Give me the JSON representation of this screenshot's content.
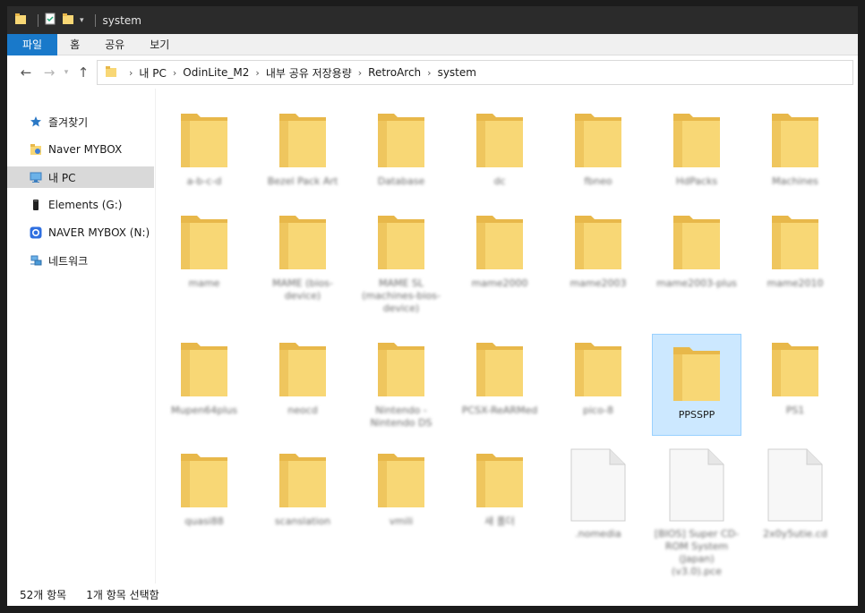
{
  "window": {
    "title": "system"
  },
  "ribbon": {
    "tabs": [
      "파일",
      "홈",
      "공유",
      "보기"
    ]
  },
  "address": {
    "crumbs": [
      "내 PC",
      "OdinLite_M2",
      "내부 공유 저장용량",
      "RetroArch",
      "system"
    ]
  },
  "sidebar": {
    "items": [
      {
        "label": "즐겨찾기",
        "icon": "star-icon"
      },
      {
        "label": "Naver MYBOX",
        "icon": "cloud-folder-icon"
      },
      {
        "label": "내 PC",
        "icon": "pc-icon"
      },
      {
        "label": "Elements (G:)",
        "icon": "drive-icon"
      },
      {
        "label": "NAVER MYBOX (N:)",
        "icon": "mybox-drive-icon"
      },
      {
        "label": "네트워크",
        "icon": "network-icon"
      }
    ]
  },
  "content": {
    "items": [
      {
        "label": "a-b-c-d",
        "type": "folder",
        "blur": true
      },
      {
        "label": "Bezel Pack Art",
        "type": "folder",
        "blur": true
      },
      {
        "label": "Database",
        "type": "folder",
        "blur": true
      },
      {
        "label": "dc",
        "type": "folder",
        "blur": true
      },
      {
        "label": "fbneo",
        "type": "folder",
        "blur": true
      },
      {
        "label": "HdPacks",
        "type": "folder",
        "blur": true
      },
      {
        "label": "Machines",
        "type": "folder",
        "blur": true
      },
      {
        "label": "mame",
        "type": "folder",
        "blur": true
      },
      {
        "label": "MAME (bios-device)",
        "type": "folder",
        "blur": true
      },
      {
        "label": "MAME SL (machines-bios-device)",
        "type": "folder",
        "blur": true
      },
      {
        "label": "mame2000",
        "type": "folder",
        "blur": true
      },
      {
        "label": "mame2003",
        "type": "folder",
        "blur": true
      },
      {
        "label": "mame2003-plus",
        "type": "folder",
        "blur": true
      },
      {
        "label": "mame2010",
        "type": "folder",
        "blur": true
      },
      {
        "label": "Mupen64plus",
        "type": "folder",
        "blur": true
      },
      {
        "label": "neocd",
        "type": "folder",
        "blur": true
      },
      {
        "label": "Nintendo - Nintendo DS",
        "type": "folder",
        "blur": true
      },
      {
        "label": "PCSX-ReARMed",
        "type": "folder",
        "blur": true
      },
      {
        "label": "pico-8",
        "type": "folder",
        "blur": true
      },
      {
        "label": "PPSSPP",
        "type": "folder",
        "blur": false,
        "selected": true
      },
      {
        "label": "PS1",
        "type": "folder",
        "blur": true
      },
      {
        "label": "quasi88",
        "type": "folder",
        "blur": true
      },
      {
        "label": "scanslation",
        "type": "folder",
        "blur": true
      },
      {
        "label": "vmili",
        "type": "folder",
        "blur": true
      },
      {
        "label": "새 폴더",
        "type": "folder",
        "blur": true
      },
      {
        "label": ".nomedia",
        "type": "file",
        "blur": true
      },
      {
        "label": "[BIOS] Super CD-ROM System (Japan) (v3.0).pce",
        "type": "file",
        "blur": true
      },
      {
        "label": "2x0y5utie.cd",
        "type": "file",
        "blur": true
      }
    ]
  },
  "status": {
    "count": "52개 항목",
    "selected": "1개 항목 선택함"
  },
  "colors": {
    "accent": "#1979ca",
    "folder": "#f8d775",
    "folder_dark": "#e8b84a",
    "selection": "#cce8ff"
  }
}
